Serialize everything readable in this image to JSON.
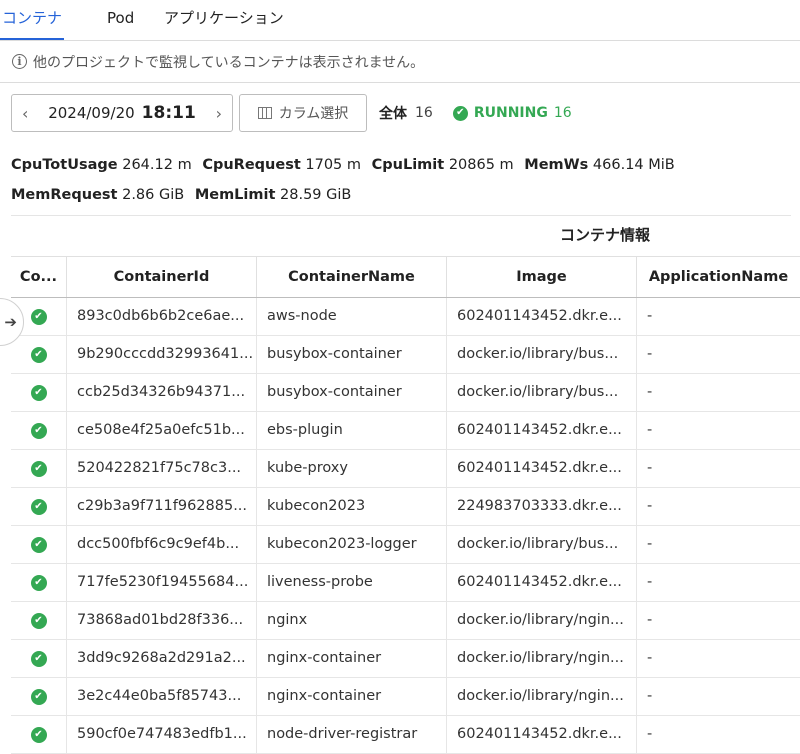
{
  "tabs": [
    "コンテナ",
    "Pod",
    "アプリケーション"
  ],
  "notice": "他のプロジェクトで監視しているコンテナは表示されません。",
  "toolbar": {
    "date": "2024/09/20",
    "time": "18:11",
    "column_select": "カラム選択",
    "total_label": "全体",
    "total_count": "16",
    "running_label": "RUNNING",
    "running_count": "16"
  },
  "metrics": [
    {
      "label": "CpuTotUsage",
      "value": "264.12 m"
    },
    {
      "label": "CpuRequest",
      "value": "1705 m"
    },
    {
      "label": "CpuLimit",
      "value": "20865 m"
    },
    {
      "label": "MemWs",
      "value": "466.14 MiB"
    },
    {
      "label": "MemRequest",
      "value": "2.86 GiB"
    },
    {
      "label": "MemLimit",
      "value": "28.59 GiB"
    }
  ],
  "group_header": "コンテナ情報",
  "columns": [
    "Co...",
    "ContainerId",
    "ContainerName",
    "Image",
    "ApplicationName"
  ],
  "rows": [
    {
      "id": "893c0db6b6b2ce6ae...",
      "name": "aws-node",
      "image": "602401143452.dkr.e...",
      "app": "-"
    },
    {
      "id": "9b290cccdd32993641...",
      "name": "busybox-container",
      "image": "docker.io/library/bus...",
      "app": "-"
    },
    {
      "id": "ccb25d34326b94371...",
      "name": "busybox-container",
      "image": "docker.io/library/bus...",
      "app": "-"
    },
    {
      "id": "ce508e4f25a0efc51b...",
      "name": "ebs-plugin",
      "image": "602401143452.dkr.e...",
      "app": "-"
    },
    {
      "id": "520422821f75c78c3...",
      "name": "kube-proxy",
      "image": "602401143452.dkr.e...",
      "app": "-"
    },
    {
      "id": "c29b3a9f711f962885...",
      "name": "kubecon2023",
      "image": "224983703333.dkr.e...",
      "app": "-"
    },
    {
      "id": "dcc500fbf6c9c9ef4b...",
      "name": "kubecon2023-logger",
      "image": "docker.io/library/bus...",
      "app": "-"
    },
    {
      "id": "717fe5230f19455684...",
      "name": "liveness-probe",
      "image": "602401143452.dkr.e...",
      "app": "-"
    },
    {
      "id": "73868ad01bd28f336...",
      "name": "nginx",
      "image": "docker.io/library/ngin...",
      "app": "-"
    },
    {
      "id": "3dd9c9268a2d291a2...",
      "name": "nginx-container",
      "image": "docker.io/library/ngin...",
      "app": "-"
    },
    {
      "id": "3e2c44e0ba5f85743...",
      "name": "nginx-container",
      "image": "docker.io/library/ngin...",
      "app": "-"
    },
    {
      "id": "590cf0e747483edfb1...",
      "name": "node-driver-registrar",
      "image": "602401143452.dkr.e...",
      "app": "-"
    }
  ],
  "colors": {
    "accent": "#2563d8",
    "running": "#34a853"
  }
}
